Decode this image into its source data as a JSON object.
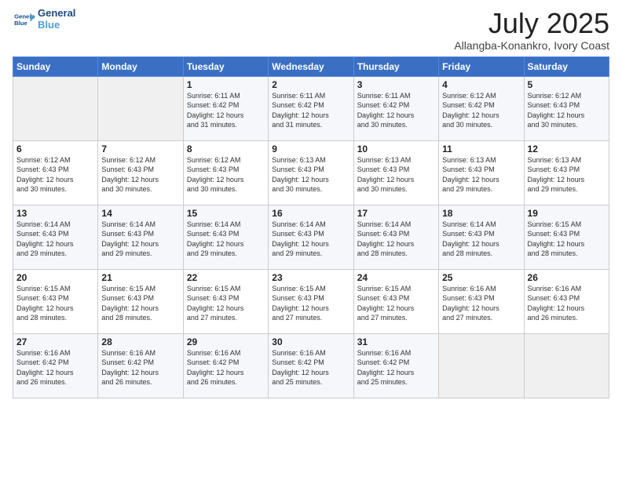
{
  "header": {
    "logo_line1": "General",
    "logo_line2": "Blue",
    "month_title": "July 2025",
    "location": "Allangba-Konankro, Ivory Coast"
  },
  "weekdays": [
    "Sunday",
    "Monday",
    "Tuesday",
    "Wednesday",
    "Thursday",
    "Friday",
    "Saturday"
  ],
  "weeks": [
    [
      {
        "day": "",
        "info": ""
      },
      {
        "day": "",
        "info": ""
      },
      {
        "day": "1",
        "info": "Sunrise: 6:11 AM\nSunset: 6:42 PM\nDaylight: 12 hours\nand 31 minutes."
      },
      {
        "day": "2",
        "info": "Sunrise: 6:11 AM\nSunset: 6:42 PM\nDaylight: 12 hours\nand 31 minutes."
      },
      {
        "day": "3",
        "info": "Sunrise: 6:11 AM\nSunset: 6:42 PM\nDaylight: 12 hours\nand 30 minutes."
      },
      {
        "day": "4",
        "info": "Sunrise: 6:12 AM\nSunset: 6:42 PM\nDaylight: 12 hours\nand 30 minutes."
      },
      {
        "day": "5",
        "info": "Sunrise: 6:12 AM\nSunset: 6:43 PM\nDaylight: 12 hours\nand 30 minutes."
      }
    ],
    [
      {
        "day": "6",
        "info": "Sunrise: 6:12 AM\nSunset: 6:43 PM\nDaylight: 12 hours\nand 30 minutes."
      },
      {
        "day": "7",
        "info": "Sunrise: 6:12 AM\nSunset: 6:43 PM\nDaylight: 12 hours\nand 30 minutes."
      },
      {
        "day": "8",
        "info": "Sunrise: 6:12 AM\nSunset: 6:43 PM\nDaylight: 12 hours\nand 30 minutes."
      },
      {
        "day": "9",
        "info": "Sunrise: 6:13 AM\nSunset: 6:43 PM\nDaylight: 12 hours\nand 30 minutes."
      },
      {
        "day": "10",
        "info": "Sunrise: 6:13 AM\nSunset: 6:43 PM\nDaylight: 12 hours\nand 30 minutes."
      },
      {
        "day": "11",
        "info": "Sunrise: 6:13 AM\nSunset: 6:43 PM\nDaylight: 12 hours\nand 29 minutes."
      },
      {
        "day": "12",
        "info": "Sunrise: 6:13 AM\nSunset: 6:43 PM\nDaylight: 12 hours\nand 29 minutes."
      }
    ],
    [
      {
        "day": "13",
        "info": "Sunrise: 6:14 AM\nSunset: 6:43 PM\nDaylight: 12 hours\nand 29 minutes."
      },
      {
        "day": "14",
        "info": "Sunrise: 6:14 AM\nSunset: 6:43 PM\nDaylight: 12 hours\nand 29 minutes."
      },
      {
        "day": "15",
        "info": "Sunrise: 6:14 AM\nSunset: 6:43 PM\nDaylight: 12 hours\nand 29 minutes."
      },
      {
        "day": "16",
        "info": "Sunrise: 6:14 AM\nSunset: 6:43 PM\nDaylight: 12 hours\nand 29 minutes."
      },
      {
        "day": "17",
        "info": "Sunrise: 6:14 AM\nSunset: 6:43 PM\nDaylight: 12 hours\nand 28 minutes."
      },
      {
        "day": "18",
        "info": "Sunrise: 6:14 AM\nSunset: 6:43 PM\nDaylight: 12 hours\nand 28 minutes."
      },
      {
        "day": "19",
        "info": "Sunrise: 6:15 AM\nSunset: 6:43 PM\nDaylight: 12 hours\nand 28 minutes."
      }
    ],
    [
      {
        "day": "20",
        "info": "Sunrise: 6:15 AM\nSunset: 6:43 PM\nDaylight: 12 hours\nand 28 minutes."
      },
      {
        "day": "21",
        "info": "Sunrise: 6:15 AM\nSunset: 6:43 PM\nDaylight: 12 hours\nand 28 minutes."
      },
      {
        "day": "22",
        "info": "Sunrise: 6:15 AM\nSunset: 6:43 PM\nDaylight: 12 hours\nand 27 minutes."
      },
      {
        "day": "23",
        "info": "Sunrise: 6:15 AM\nSunset: 6:43 PM\nDaylight: 12 hours\nand 27 minutes."
      },
      {
        "day": "24",
        "info": "Sunrise: 6:15 AM\nSunset: 6:43 PM\nDaylight: 12 hours\nand 27 minutes."
      },
      {
        "day": "25",
        "info": "Sunrise: 6:16 AM\nSunset: 6:43 PM\nDaylight: 12 hours\nand 27 minutes."
      },
      {
        "day": "26",
        "info": "Sunrise: 6:16 AM\nSunset: 6:43 PM\nDaylight: 12 hours\nand 26 minutes."
      }
    ],
    [
      {
        "day": "27",
        "info": "Sunrise: 6:16 AM\nSunset: 6:42 PM\nDaylight: 12 hours\nand 26 minutes."
      },
      {
        "day": "28",
        "info": "Sunrise: 6:16 AM\nSunset: 6:42 PM\nDaylight: 12 hours\nand 26 minutes."
      },
      {
        "day": "29",
        "info": "Sunrise: 6:16 AM\nSunset: 6:42 PM\nDaylight: 12 hours\nand 26 minutes."
      },
      {
        "day": "30",
        "info": "Sunrise: 6:16 AM\nSunset: 6:42 PM\nDaylight: 12 hours\nand 25 minutes."
      },
      {
        "day": "31",
        "info": "Sunrise: 6:16 AM\nSunset: 6:42 PM\nDaylight: 12 hours\nand 25 minutes."
      },
      {
        "day": "",
        "info": ""
      },
      {
        "day": "",
        "info": ""
      }
    ]
  ]
}
